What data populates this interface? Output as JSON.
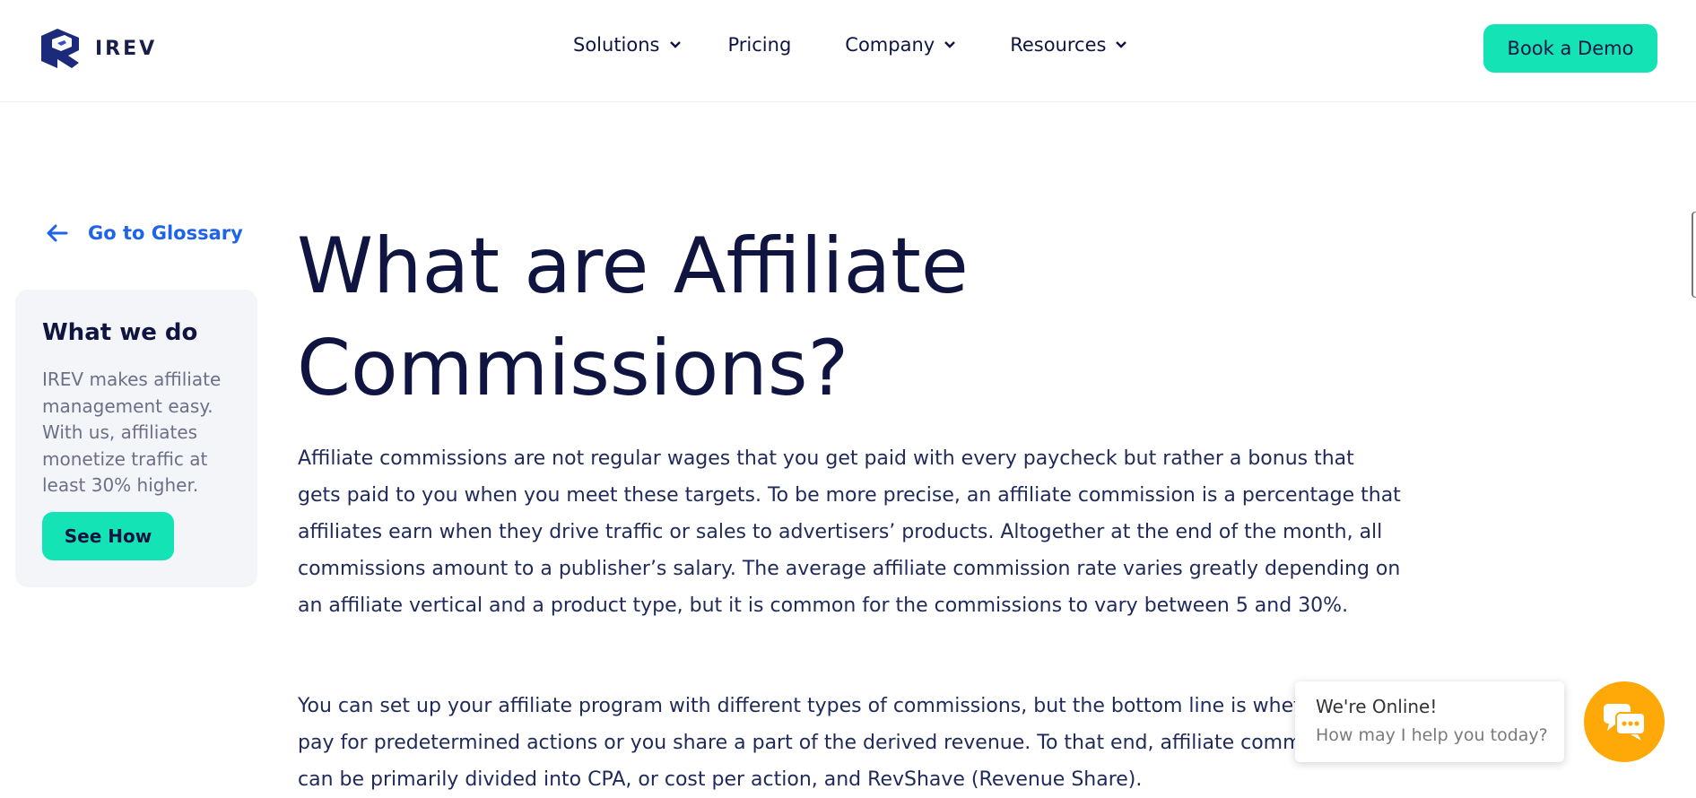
{
  "header": {
    "logo_text": "IREV",
    "nav": [
      {
        "label": "Solutions",
        "has_dropdown": true
      },
      {
        "label": "Pricing",
        "has_dropdown": false
      },
      {
        "label": "Company",
        "has_dropdown": true
      },
      {
        "label": "Resources",
        "has_dropdown": true
      }
    ],
    "cta_label": "Book a Demo"
  },
  "sidebar": {
    "back_label": "Go to Glossary",
    "card_title": "What we do",
    "card_text": "IREV makes affiliate management easy. With us, affiliates monetize traffic at least 30% higher.",
    "card_button": "See How"
  },
  "main": {
    "title": "What are Affiliate Commissions?",
    "paragraphs": [
      "Affiliate commissions are not regular wages that you get paid with every paycheck but rather a bonus that gets paid to you when you meet these targets. To be more precise, an affiliate commission is a percentage that affiliates earn when they drive traffic or sales to advertisers’ products. Altogether at the end of the month, all commissions amount to a publisher’s salary. The average affiliate commission rate varies greatly depending on an affiliate vertical and a product type, but it is common for the commissions to vary between 5 and 30%.",
      "You can set up your affiliate program with different types of commissions, but the bottom line is whether you pay for predetermined actions or you share a part of the derived revenue. To that end, affiliate commissions can be primarily divided into CPA, or cost per action, and RevShave (Revenue Share)."
    ]
  },
  "chat": {
    "title": "We're Online!",
    "subtitle": "How may I help you today?"
  },
  "colors": {
    "accent": "#14e3b5",
    "link": "#1e63e9",
    "navy": "#0f1540",
    "chat": "#ffa908"
  },
  "icons": {
    "logo": "irev-logo-icon",
    "dropdown": "chevron-down-icon",
    "back": "arrow-left-icon",
    "chat": "chat-bubbles-icon"
  }
}
